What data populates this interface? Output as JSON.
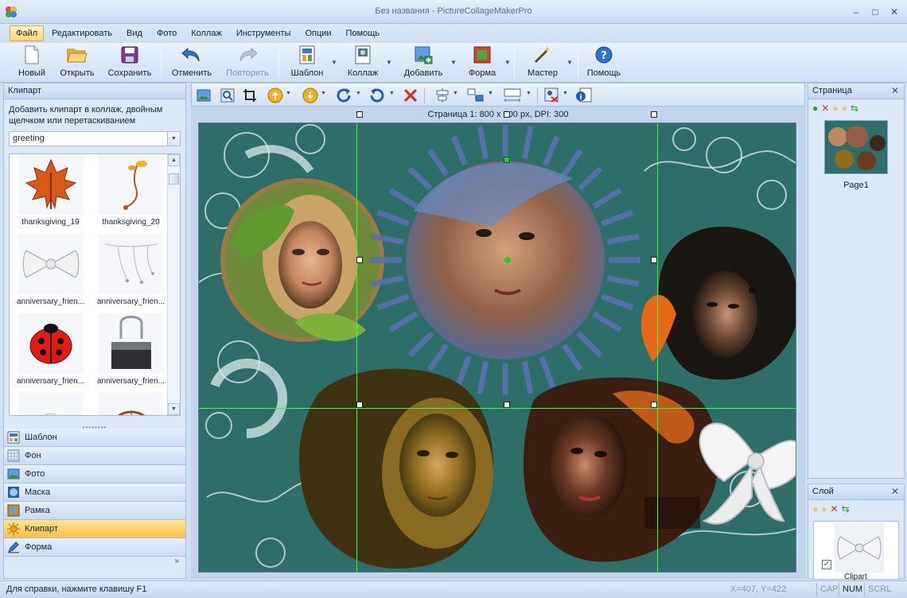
{
  "window": {
    "title": "Без названия - PictureCollageMakerPro"
  },
  "menu": [
    "Файл",
    "Редактировать",
    "Вид",
    "Фото",
    "Коллаж",
    "Инструменты",
    "Опции",
    "Помощь"
  ],
  "toolbar": {
    "new": "Новый",
    "open": "Открыть",
    "save": "Сохранить",
    "undo": "Отменить",
    "redo": "Повторить",
    "template": "Шаблон",
    "collage": "Коллаж",
    "add": "Добавить",
    "shape": "Форма",
    "wizard": "Мастер",
    "help": "Помощь"
  },
  "left": {
    "header": "Клипарт",
    "description": "Добавить клипарт в коллаж, двойным щелчком или перетаскиванием",
    "category": "greeting",
    "items": [
      "thanksgiving_19",
      "thanksgiving_20",
      "anniversary_frien...",
      "anniversary_frien...",
      "anniversary_frien...",
      "anniversary_frien..."
    ],
    "nav": [
      "Шаблон",
      "Фон",
      "Фото",
      "Маска",
      "Рамка",
      "Клипарт",
      "Форма"
    ]
  },
  "center": {
    "page_info": "Страница 1: 800 x 600 px, DPI: 300"
  },
  "right": {
    "pages_header": "Страница",
    "page_name": "Page1",
    "layers_header": "Слой",
    "layer_name": "Clipart"
  },
  "status": {
    "help": "Для справки, нажмите клавишу F1",
    "coords": "X=407, Y=422",
    "caps": "CAP",
    "num": "NUM",
    "scrl": "SCRL"
  },
  "colors": {
    "accent": "#ffbf45",
    "canvas_bg": "#2f6d68",
    "guide": "#31ff31"
  }
}
